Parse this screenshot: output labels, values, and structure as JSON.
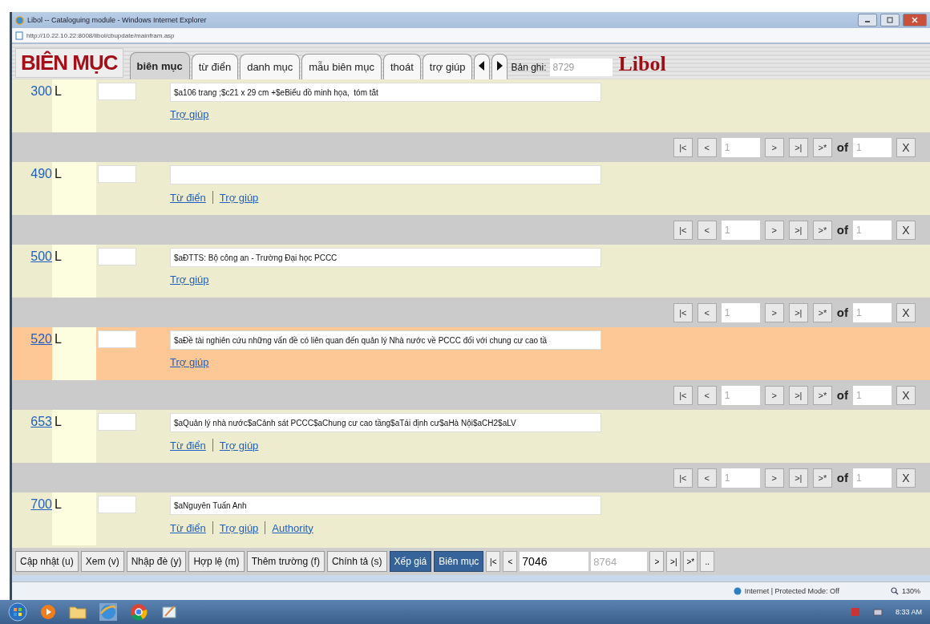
{
  "window": {
    "title": "Libol -- Cataloguing module - Windows Internet Explorer",
    "address": "http://10.22.10.22:8008/libol/cbupdate/mainfram.asp"
  },
  "header": {
    "logo": "BIÊN MỤC",
    "tabs": [
      {
        "label": "biên mục",
        "selected": true
      },
      {
        "label": "từ điển",
        "selected": false
      },
      {
        "label": "danh mục",
        "selected": false
      },
      {
        "label": "mẫu biên mục",
        "selected": false
      },
      {
        "label": "thoát",
        "selected": false
      },
      {
        "label": "trợ giúp",
        "selected": false
      }
    ],
    "record_label": "Bản ghi:",
    "record_value": "8729",
    "brand": "Libol"
  },
  "fields": [
    {
      "tag": "300",
      "linked": false,
      "indicator": "L",
      "value": "$a106 trang ;$c21 x 29 cm +$eBiểu đồ minh họa,  tóm tắt",
      "links": [
        "Trợ giúp"
      ],
      "selected": false,
      "pager": {
        "first": "|<",
        "prev": "<",
        "page": "1",
        "next": ">",
        "last": ">|",
        "new": ">*",
        "of": "of",
        "total": "1",
        "close": "X"
      }
    },
    {
      "tag": "490",
      "linked": false,
      "indicator": "L",
      "links": [
        "Từ điển",
        "Trợ giúp"
      ],
      "selected": false,
      "pager": {
        "first": "|<",
        "prev": "<",
        "page": "1",
        "next": ">",
        "last": ">|",
        "new": ">*",
        "of": "of",
        "total": "1",
        "close": "X"
      }
    },
    {
      "tag": "500",
      "linked": true,
      "indicator": "L",
      "value": "$aĐTTS: Bộ công an - Trường Đại học PCCC",
      "links": [
        "Trợ giúp"
      ],
      "selected": false,
      "pager": {
        "first": "|<",
        "prev": "<",
        "page": "1",
        "next": ">",
        "last": ">|",
        "new": ">*",
        "of": "of",
        "total": "1",
        "close": "X"
      }
    },
    {
      "tag": "520",
      "linked": true,
      "indicator": "L",
      "value": "$aĐề tài nghiên cứu những vấn đề có liên quan đến quản lý Nhà nước về PCCC đối với chung cư cao tầ",
      "links": [
        "Trợ giúp"
      ],
      "selected": true,
      "pager": {
        "first": "|<",
        "prev": "<",
        "page": "1",
        "next": ">",
        "last": ">|",
        "new": ">*",
        "of": "of",
        "total": "1",
        "close": "X"
      }
    },
    {
      "tag": "653",
      "linked": true,
      "indicator": "L",
      "value": "$aQuản lý nhà nước$aCảnh sát PCCC$aChung cư cao tầng$aTái định cư$aHà Nội$aCH2$aLV",
      "links": [
        "Từ điển",
        "Trợ giúp"
      ],
      "selected": false,
      "pager": {
        "first": "|<",
        "prev": "<",
        "page": "1",
        "next": ">",
        "last": ">|",
        "new": ">*",
        "of": "of",
        "total": "1",
        "close": "X"
      }
    },
    {
      "tag": "700",
      "linked": true,
      "indicator": "L",
      "value": "$aNguyễn Tuấn Anh",
      "links": [
        "Từ điển",
        "Trợ giúp",
        "Authority"
      ],
      "selected": false
    }
  ],
  "actions": [
    {
      "label": "Cập nhật (u)",
      "highlighted": false
    },
    {
      "label": "Xem (v)",
      "highlighted": false
    },
    {
      "label": "Nhập đè (y)",
      "highlighted": false
    },
    {
      "label": "Hợp lệ (m)",
      "highlighted": false
    },
    {
      "label": "Thêm trường (f)",
      "highlighted": false
    },
    {
      "label": "Chính tả (s)",
      "highlighted": false
    },
    {
      "label": "Xếp giá",
      "highlighted": true
    },
    {
      "label": "Biên mục",
      "highlighted": true
    }
  ],
  "record_nav": {
    "first": "|<",
    "prev": "<",
    "current": "7046",
    "total": "8764",
    "next": ">",
    "last": ">|",
    "new": ">*",
    "more": ".."
  },
  "status_bar": {
    "zone": "Internet | Protected Mode: Off",
    "zoom": "130%"
  },
  "taskbar": {
    "time": "8:33 AM"
  }
}
